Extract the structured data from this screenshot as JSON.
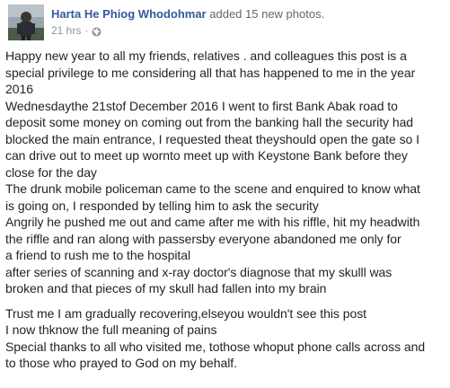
{
  "post": {
    "author_name": "Harta He Phiog Whodohmar",
    "action_text": "added 15 new photos.",
    "timestamp": "21 hrs",
    "separator": "·",
    "privacy_icon": "globe-icon"
  },
  "body": {
    "paragraph1": [
      "Happy new year to all my friends, relatives . and colleagues this post is a",
      "special privilege to me considering all that has happened to me in the year",
      "2016",
      "Wednesdaythe 21stof December 2016 I went to first Bank Abak road to",
      "deposit some money on coming out from the banking hall the security had",
      "blocked the main entrance, I requested theat theyshould open the gate so I",
      "can drive out to meet up wornto meet up with Keystone Bank before they",
      "close for the day",
      "The drunk mobile policeman came to the scene and enquired to know what",
      "is going on, I responded by telling him to ask the security",
      "Angrily he pushed me out and came after me with his riffle, hit my headwith",
      "the riffle and ran along with passersby everyone abandoned me only for",
      "a friend to rush me to the hospital",
      "after series of scanning and x-ray doctor's diagnose that my skulll was",
      "broken and that pieces of my skull had fallen into my brain"
    ],
    "paragraph2": [
      "Trust me I am gradually recovering,elseyou wouldn't see this post",
      "I now thknow the full meaning of pains",
      "Special thanks to all who visited me, tothose whoput phone calls across and",
      "to those who prayed to God on my behalf."
    ]
  }
}
